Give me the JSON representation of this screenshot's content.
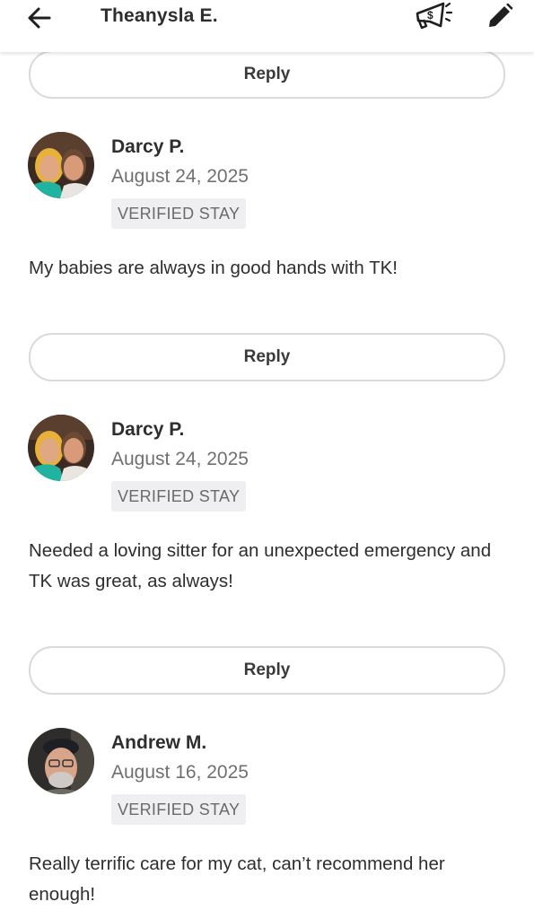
{
  "header": {
    "title": "Theanysla E.",
    "back_icon": "arrow-left-icon",
    "promo_icon": "megaphone-dollar-icon",
    "edit_icon": "pencil-icon"
  },
  "reply_label": "Reply",
  "reviews": [
    {
      "name": "Darcy P.",
      "date": "August 24, 2025",
      "badge": "VERIFIED STAY",
      "text": "My babies are always in good hands with TK!"
    },
    {
      "name": "Darcy P.",
      "date": "August 24, 2025",
      "badge": "VERIFIED STAY",
      "text": "Needed a loving sitter for an unexpected emergency and TK was great, as always!"
    },
    {
      "name": "Andrew M.",
      "date": "August 16, 2025",
      "badge": "VERIFIED STAY",
      "text": "Really terrific care for my cat, can’t recommend her enough!"
    }
  ],
  "colors": {
    "text_primary": "#2e2e2e",
    "text_secondary": "#707070",
    "badge_bg": "#efeff1",
    "button_border": "#d9d9de"
  }
}
